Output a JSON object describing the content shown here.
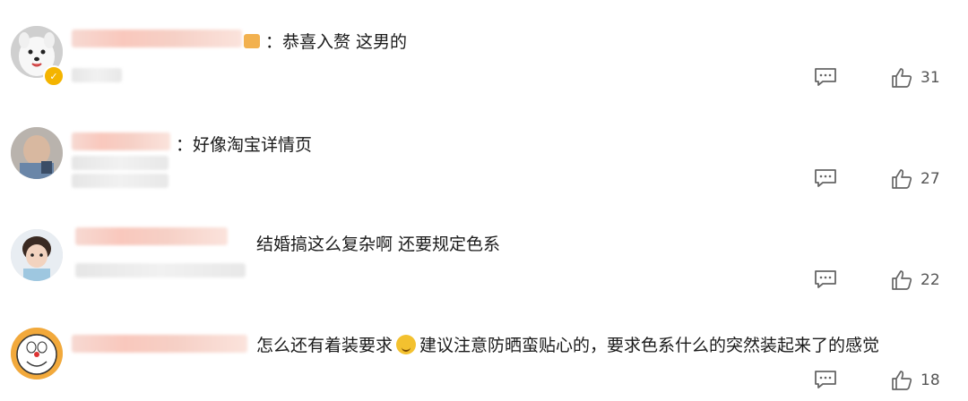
{
  "comments": [
    {
      "text": "：恭喜入赘 这男的",
      "likes": "31"
    },
    {
      "text": "：好像淘宝详情页",
      "likes": "27"
    },
    {
      "text": "结婚搞这么复杂啊 还要规定色系",
      "likes": "22"
    },
    {
      "text_before": "怎么还有着装要求",
      "text_after": "建议注意防晒蛮贴心的，要求色系什么的突然装起来了的感觉",
      "likes": "18"
    }
  ],
  "icons": {
    "reply": "reply-icon",
    "like": "thumbs-up-icon",
    "emoji": "sweat-smile-emoji-icon"
  },
  "colors": {
    "text": "#1a1a1a",
    "meta": "#555555",
    "verified": "#f4b400"
  }
}
